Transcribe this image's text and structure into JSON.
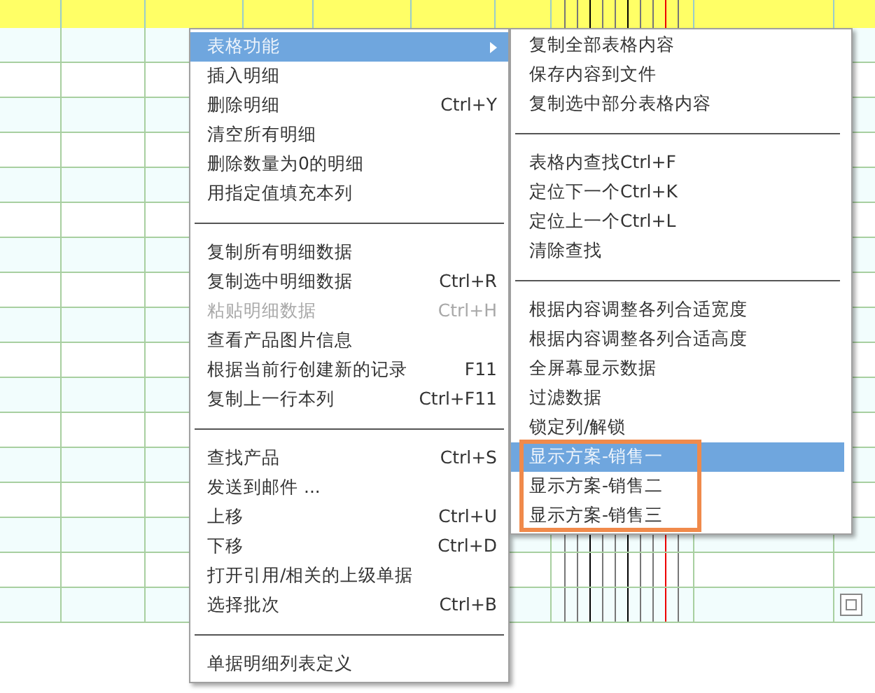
{
  "context_menu": {
    "sections": [
      {
        "items": [
          {
            "label": "表格功能",
            "selected": true,
            "disabled": false,
            "has_submenu": true
          },
          {
            "label": "插入明细",
            "selected": false,
            "disabled": false,
            "has_submenu": false
          },
          {
            "label": "删除明细",
            "shortcut": "Ctrl+Y",
            "selected": false,
            "disabled": false,
            "has_submenu": false
          },
          {
            "label": "清空所有明细",
            "selected": false,
            "disabled": false,
            "has_submenu": false
          },
          {
            "label": "删除数量为0的明细",
            "selected": false,
            "disabled": false,
            "has_submenu": false
          },
          {
            "label": "用指定值填充本列",
            "selected": false,
            "disabled": false,
            "has_submenu": false
          }
        ]
      },
      {
        "items": [
          {
            "label": "复制所有明细数据",
            "selected": false,
            "disabled": false,
            "has_submenu": false
          },
          {
            "label": "复制选中明细数据",
            "shortcut": "Ctrl+R",
            "selected": false,
            "disabled": false,
            "has_submenu": false
          },
          {
            "label": "粘贴明细数据",
            "shortcut": "Ctrl+H",
            "selected": false,
            "disabled": true,
            "has_submenu": false
          },
          {
            "label": "查看产品图片信息",
            "selected": false,
            "disabled": false,
            "has_submenu": false
          },
          {
            "label": "根据当前行创建新的记录",
            "shortcut": "F11",
            "selected": false,
            "disabled": false,
            "has_submenu": false
          },
          {
            "label": "复制上一行本列",
            "shortcut": "Ctrl+F11",
            "selected": false,
            "disabled": false,
            "has_submenu": false
          }
        ]
      },
      {
        "items": [
          {
            "label": "查找产品",
            "shortcut": "Ctrl+S",
            "selected": false,
            "disabled": false,
            "has_submenu": false
          },
          {
            "label": "发送到邮件 ...",
            "selected": false,
            "disabled": false,
            "has_submenu": false
          },
          {
            "label": "上移",
            "shortcut": "Ctrl+U",
            "selected": false,
            "disabled": false,
            "has_submenu": false
          },
          {
            "label": "下移",
            "shortcut": "Ctrl+D",
            "selected": false,
            "disabled": false,
            "has_submenu": false
          },
          {
            "label": "打开引用/相关的上级单据",
            "selected": false,
            "disabled": false,
            "has_submenu": false
          },
          {
            "label": "选择批次",
            "shortcut": "Ctrl+B",
            "selected": false,
            "disabled": false,
            "has_submenu": false
          }
        ]
      },
      {
        "items": [
          {
            "label": "单据明细列表定义",
            "selected": false,
            "disabled": false,
            "has_submenu": false
          }
        ]
      }
    ]
  },
  "submenu": {
    "sections": [
      {
        "items": [
          {
            "label": "复制全部表格内容",
            "selected": false,
            "outlined": false
          },
          {
            "label": "保存内容到文件",
            "selected": false,
            "outlined": false
          },
          {
            "label": "复制选中部分表格内容",
            "selected": false,
            "outlined": false
          }
        ]
      },
      {
        "items": [
          {
            "label": "表格内查找Ctrl+F",
            "selected": false,
            "outlined": false
          },
          {
            "label": "定位下一个Ctrl+K",
            "selected": false,
            "outlined": false
          },
          {
            "label": "定位上一个Ctrl+L",
            "selected": false,
            "outlined": false
          },
          {
            "label": "清除查找",
            "selected": false,
            "outlined": false
          }
        ]
      },
      {
        "items": [
          {
            "label": "根据内容调整各列合适宽度",
            "selected": false,
            "outlined": false
          },
          {
            "label": "根据内容调整各列合适高度",
            "selected": false,
            "outlined": false
          },
          {
            "label": "全屏幕显示数据",
            "selected": false,
            "outlined": false
          },
          {
            "label": "过滤数据",
            "selected": false,
            "outlined": false
          },
          {
            "label": "锁定列/解锁",
            "selected": false,
            "outlined": false
          },
          {
            "label": "显示方案-销售一",
            "selected": true,
            "outlined": true
          },
          {
            "label": "显示方案-销售二",
            "selected": false,
            "outlined": true
          },
          {
            "label": "显示方案-销售三",
            "selected": false,
            "outlined": true
          }
        ]
      }
    ]
  }
}
